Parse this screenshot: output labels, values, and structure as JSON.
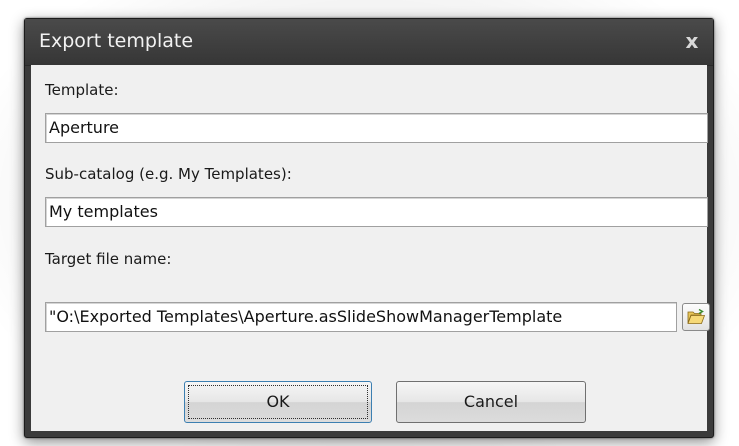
{
  "dialog": {
    "title": "Export template",
    "close_glyph": "x"
  },
  "form": {
    "template_label": "Template:",
    "template_value": "Aperture",
    "subcatalog_label": "Sub-catalog (e.g. My Templates):",
    "subcatalog_value": "My templates",
    "target_label": "Target file name:",
    "target_value": "\"O:\\Exported Templates\\Aperture.asSlideShowManagerTemplate",
    "browse_icon": "folder-open-icon"
  },
  "buttons": {
    "ok_label": "OK",
    "cancel_label": "Cancel"
  },
  "colors": {
    "titlebar": "#3b3b3b",
    "client": "#f0f0f0",
    "default_button_border": "#3c7fb1"
  }
}
